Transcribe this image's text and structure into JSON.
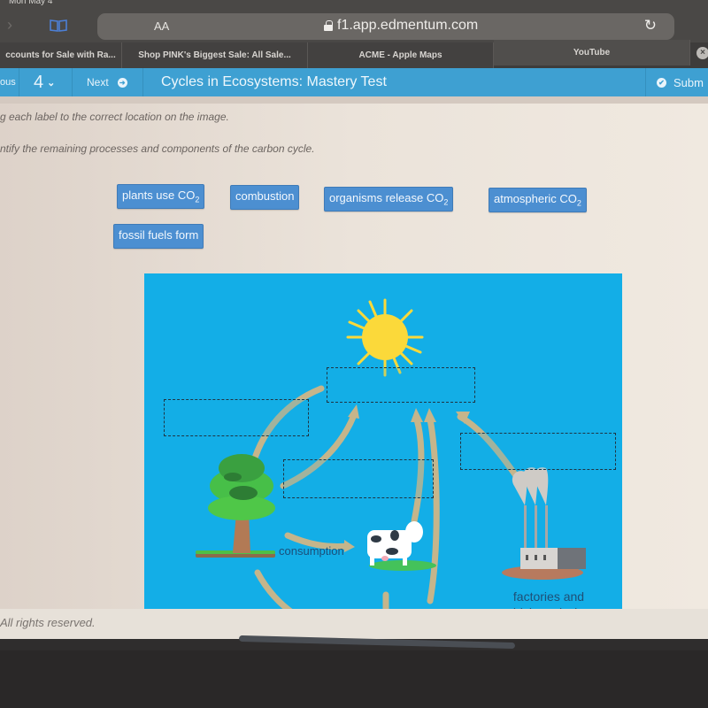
{
  "status_bar": {
    "date": "Mon May 4"
  },
  "browser": {
    "text_size_label": "AA",
    "url": "f1.app.edmentum.com",
    "icons": {
      "forward": "chevron-right-icon",
      "bookmarks": "book-icon",
      "lock": "lock-icon",
      "reload": "reload-icon"
    }
  },
  "tabs": [
    {
      "label": "ccounts for Sale with Ra...",
      "active": false
    },
    {
      "label": "Shop PINK's Biggest Sale: All Sale...",
      "active": false
    },
    {
      "label": "ACME - Apple Maps",
      "active": false
    },
    {
      "label": "YouTube",
      "active": true
    }
  ],
  "tab_close_glyph": "×",
  "app_header": {
    "previous_label": "ous",
    "question_number": "4",
    "question_chevron": "⌄",
    "next_label": "Next",
    "next_glyph": "➜",
    "title": "Cycles in Ecosystems: Mastery Test",
    "submit_label": "Subm",
    "submit_glyph": "✔"
  },
  "instructions": {
    "line1": "g each label to the correct location on the image.",
    "line2": "ntify the remaining processes and components of the carbon cycle."
  },
  "labels": [
    {
      "text": "plants use CO",
      "sub": "2"
    },
    {
      "text": "combustion",
      "sub": ""
    },
    {
      "text": "organisms release CO",
      "sub": "2"
    },
    {
      "text": "atmospheric CO",
      "sub": "2"
    },
    {
      "text": "fossil fuels form",
      "sub": ""
    }
  ],
  "diagram": {
    "consumption_label": "consumption",
    "factories_label_line1": "factories and",
    "factories_label_line2": "vehicle emissions",
    "drop_zone_count": 4,
    "colors": {
      "sky": "#13aee7",
      "arrow": "#c5b58b",
      "sun": "#fbd93a"
    }
  },
  "footer": {
    "copyright": "All rights reserved."
  }
}
